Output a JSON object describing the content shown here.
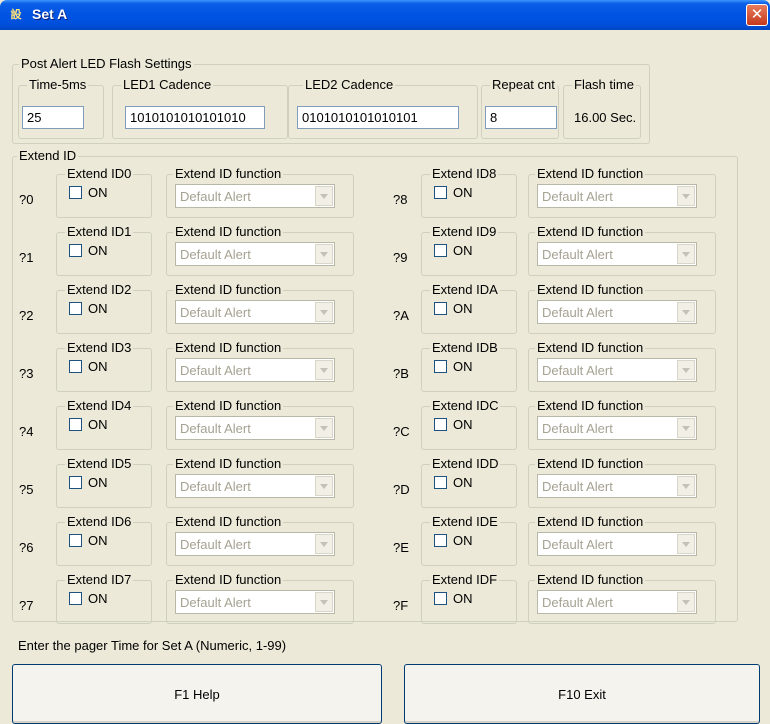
{
  "window": {
    "title": "Set A",
    "app_icon_text": "設",
    "close_label": "✕"
  },
  "post_alert": {
    "group_label": "Post Alert LED Flash Settings",
    "time_label": "Time-5ms",
    "time_value": "25",
    "led1_label": "LED1 Cadence",
    "led1_value": "1010101010101010",
    "led2_label": "LED2 Cadence",
    "led2_value": "0101010101010101",
    "repeat_label": "Repeat cnt",
    "repeat_value": "8",
    "flash_label": "Flash time",
    "flash_value": "16.00 Sec."
  },
  "extend": {
    "group_label": "Extend ID",
    "on_label": "ON",
    "function_label": "Extend ID function",
    "function_value": "Default Alert",
    "left": [
      {
        "row_label": "?0",
        "id_label": "Extend ID0"
      },
      {
        "row_label": "?1",
        "id_label": "Extend ID1"
      },
      {
        "row_label": "?2",
        "id_label": "Extend ID2"
      },
      {
        "row_label": "?3",
        "id_label": "Extend ID3"
      },
      {
        "row_label": "?4",
        "id_label": "Extend ID4"
      },
      {
        "row_label": "?5",
        "id_label": "Extend ID5"
      },
      {
        "row_label": "?6",
        "id_label": "Extend ID6"
      },
      {
        "row_label": "?7",
        "id_label": "Extend ID7"
      }
    ],
    "right": [
      {
        "row_label": "?8",
        "id_label": "Extend ID8"
      },
      {
        "row_label": "?9",
        "id_label": "Extend ID9"
      },
      {
        "row_label": "?A",
        "id_label": "Extend IDA"
      },
      {
        "row_label": "?B",
        "id_label": "Extend IDB"
      },
      {
        "row_label": "?C",
        "id_label": "Extend IDC"
      },
      {
        "row_label": "?D",
        "id_label": "Extend IDD"
      },
      {
        "row_label": "?E",
        "id_label": "Extend IDE"
      },
      {
        "row_label": "?F",
        "id_label": "Extend IDF"
      }
    ]
  },
  "status_text": "Enter the pager Time for Set A (Numeric, 1-99)",
  "buttons": {
    "help": "F1 Help",
    "exit": "F10 Exit"
  },
  "colors": {
    "titlebar": "#0054e3",
    "face": "#ece9d8",
    "close": "#c6391d"
  }
}
